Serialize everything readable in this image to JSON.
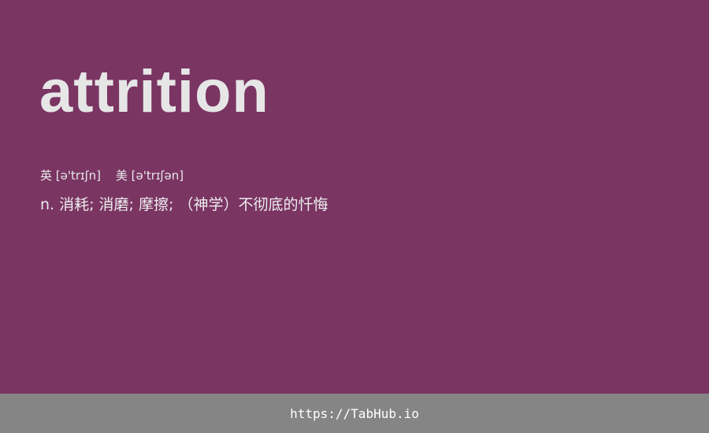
{
  "card": {
    "word": "attrition",
    "phonetics": {
      "uk_label": "英",
      "uk_ipa": "[ə'trɪʃn]",
      "us_label": "美",
      "us_ipa": "[ə'trɪʃən]"
    },
    "definition": "n. 消耗; 消磨; 摩擦; （神学）不彻底的忏悔"
  },
  "footer": {
    "link_text": "https://TabHub.io"
  },
  "colors": {
    "background": "#7a3563",
    "footer_background": "#858585",
    "text": "#e6e6e6"
  }
}
